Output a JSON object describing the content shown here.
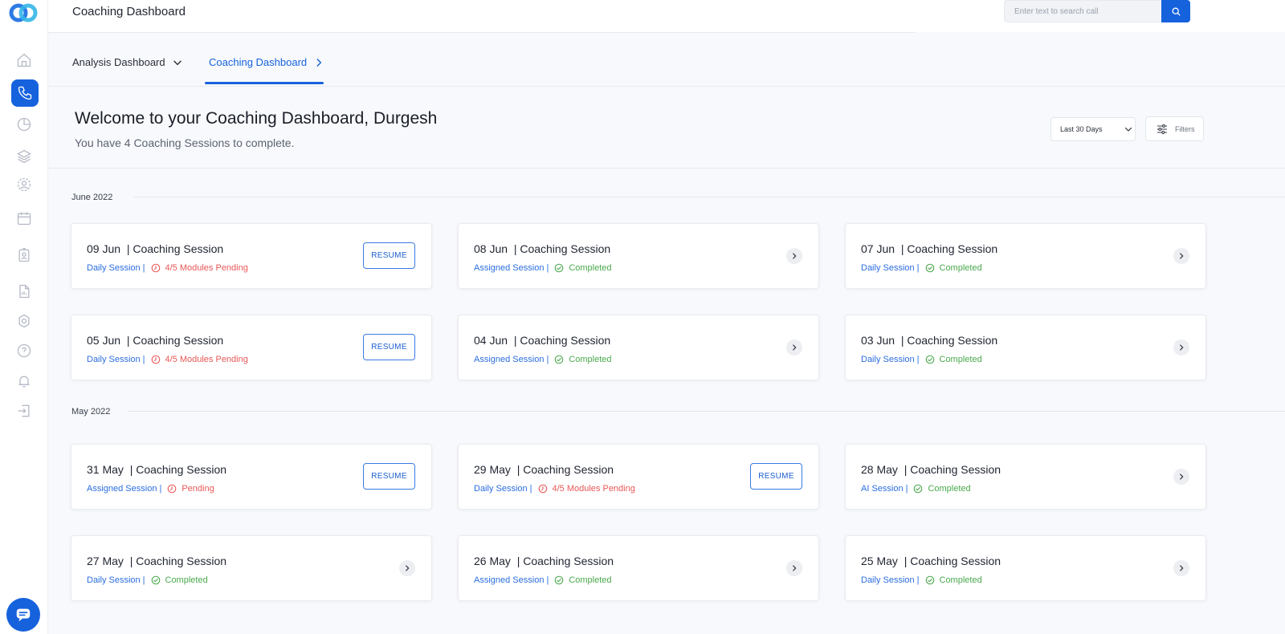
{
  "app": {
    "title": "Coaching Dashboard"
  },
  "search": {
    "placeholder": "Enter text to search call"
  },
  "sidebar": {
    "items": [
      {
        "name": "home",
        "icon": "home-icon"
      },
      {
        "name": "calls",
        "icon": "phone-icon",
        "active": true
      },
      {
        "name": "analytics",
        "icon": "pie-chart-icon"
      },
      {
        "name": "layers",
        "icon": "layers-icon"
      },
      {
        "name": "coaching",
        "icon": "user-gear-icon"
      },
      {
        "name": "calendar",
        "icon": "calendar-icon"
      },
      {
        "name": "profile",
        "icon": "id-badge-icon"
      },
      {
        "name": "reports",
        "icon": "report-icon"
      },
      {
        "name": "settings",
        "icon": "settings-icon"
      },
      {
        "name": "help",
        "icon": "help-icon"
      },
      {
        "name": "notifications",
        "icon": "bell-icon"
      },
      {
        "name": "logout",
        "icon": "logout-icon"
      }
    ]
  },
  "tabs": [
    {
      "label": "Analysis Dashboard",
      "icon": "chevron-down-icon"
    },
    {
      "label": "Coaching Dashboard",
      "icon": "chevron-right-icon",
      "active": true
    }
  ],
  "welcome": {
    "title": "Welcome to your Coaching Dashboard, Durgesh",
    "subtitle": "You have 4 Coaching Sessions to complete."
  },
  "controls": {
    "date_range": "Last 30 Days",
    "filters_label": "Filters"
  },
  "colors": {
    "accent": "#1662dd",
    "completed": "#4aa94c",
    "pending": "#ea5757"
  },
  "groups": [
    {
      "month": "June 2022",
      "sessions": [
        {
          "title": "09 Jun  | Coaching Session",
          "type": "Daily Session",
          "status": "4/5 Modules Pending",
          "state": "pending",
          "action": "RESUME"
        },
        {
          "title": "08 Jun  | Coaching Session",
          "type": "Assigned Session",
          "status": "Completed",
          "state": "done",
          "action": ""
        },
        {
          "title": "07 Jun  | Coaching Session",
          "type": "Daily Session",
          "status": "Completed",
          "state": "done",
          "action": ""
        },
        {
          "title": "05 Jun  | Coaching Session",
          "type": "Daily Session",
          "status": "4/5 Modules Pending",
          "state": "pending",
          "action": "RESUME"
        },
        {
          "title": "04 Jun  | Coaching Session",
          "type": "Assigned Session",
          "status": "Completed",
          "state": "done",
          "action": ""
        },
        {
          "title": "03 Jun  | Coaching Session",
          "type": "Daily Session",
          "status": "Completed",
          "state": "done",
          "action": ""
        }
      ]
    },
    {
      "month": "May 2022",
      "sessions": [
        {
          "title": "31 May  | Coaching Session",
          "type": "Assigned Session",
          "status": "Pending",
          "state": "pending",
          "action": "RESUME"
        },
        {
          "title": "29 May  | Coaching Session",
          "type": "Daily Session",
          "status": "4/5 Modules Pending",
          "state": "pending",
          "action": "RESUME"
        },
        {
          "title": "28 May  | Coaching Session",
          "type": "AI Session",
          "status": "Completed",
          "state": "done",
          "action": ""
        },
        {
          "title": "27 May  | Coaching Session",
          "type": "Daily Session",
          "status": "Completed",
          "state": "done",
          "action": ""
        },
        {
          "title": "26 May  | Coaching Session",
          "type": "Assigned Session",
          "status": "Completed",
          "state": "done",
          "action": ""
        },
        {
          "title": "25 May  | Coaching Session",
          "type": "Daily Session",
          "status": "Completed",
          "state": "done",
          "action": ""
        }
      ]
    }
  ]
}
